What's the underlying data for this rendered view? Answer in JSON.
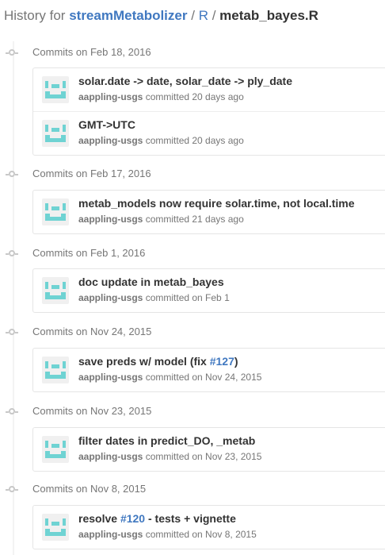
{
  "breadcrumb": {
    "prefix": "History for",
    "repo": "streamMetabolizer",
    "sep1": "/",
    "folder": "R",
    "sep2": "/",
    "file": "metab_bayes.R"
  },
  "groups": [
    {
      "date_label": "Commits on Feb 18, 2016",
      "commits": [
        {
          "message": "solar.date -> date, solar_date -> ply_date",
          "issue": "",
          "suffix": "",
          "author": "aappling-usgs",
          "when": "committed 20 days ago"
        },
        {
          "message": "GMT->UTC",
          "issue": "",
          "suffix": "",
          "author": "aappling-usgs",
          "when": "committed 20 days ago"
        }
      ]
    },
    {
      "date_label": "Commits on Feb 17, 2016",
      "commits": [
        {
          "message": "metab_models now require solar.time, not local.time",
          "issue": "",
          "suffix": "",
          "author": "aappling-usgs",
          "when": "committed 21 days ago"
        }
      ]
    },
    {
      "date_label": "Commits on Feb 1, 2016",
      "commits": [
        {
          "message": "doc update in metab_bayes",
          "issue": "",
          "suffix": "",
          "author": "aappling-usgs",
          "when": "committed on Feb 1"
        }
      ]
    },
    {
      "date_label": "Commits on Nov 24, 2015",
      "commits": [
        {
          "message": "save preds w/ model (fix ",
          "issue": "#127",
          "suffix": ")",
          "author": "aappling-usgs",
          "when": "committed on Nov 24, 2015"
        }
      ]
    },
    {
      "date_label": "Commits on Nov 23, 2015",
      "commits": [
        {
          "message": "filter dates in predict_DO, _metab",
          "issue": "",
          "suffix": "",
          "author": "aappling-usgs",
          "when": "committed on Nov 23, 2015"
        }
      ]
    },
    {
      "date_label": "Commits on Nov 8, 2015",
      "commits": [
        {
          "message": "resolve ",
          "issue": "#120",
          "suffix": " - tests + vignette",
          "author": "aappling-usgs",
          "when": "committed on Nov 8, 2015"
        }
      ]
    }
  ],
  "colors": {
    "link": "#4078c0",
    "avatar": "#6fd3d3",
    "avatar_bg": "#f0f0f0",
    "muted": "#767676"
  },
  "icons": {
    "avatar": "identicon-avatar",
    "timeline_node": "commit-node-icon"
  }
}
